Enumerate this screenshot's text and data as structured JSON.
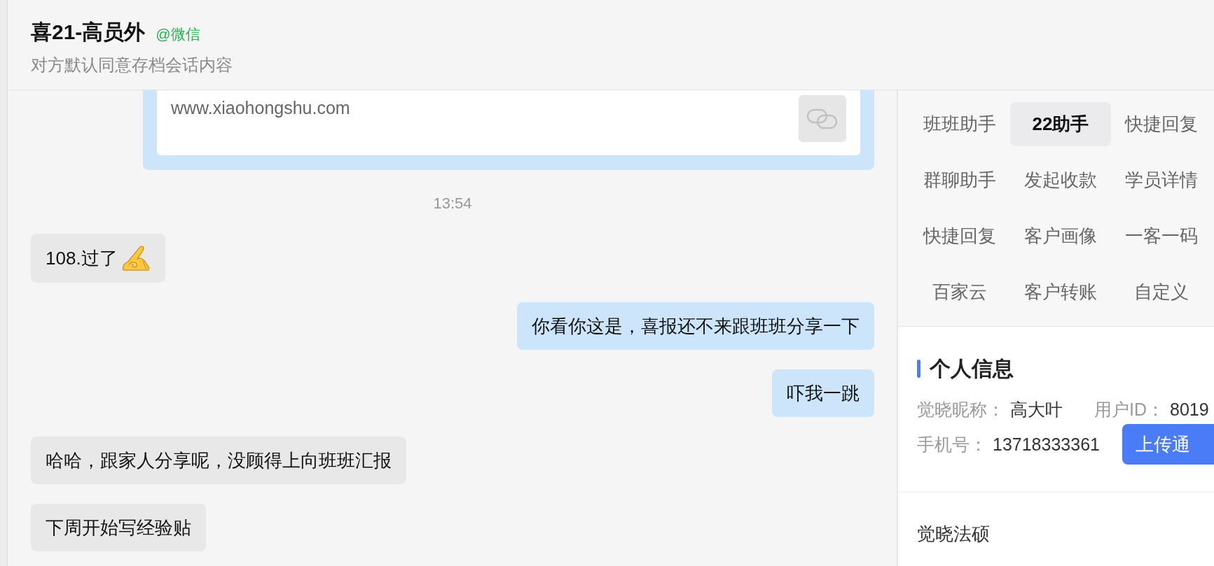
{
  "header": {
    "title": "喜21-高员外",
    "source": "@微信",
    "subtitle": "对方默认同意存档会话内容"
  },
  "messages": [
    {
      "kind": "link",
      "outgoing": true,
      "url": "www.xiaohongshu.com"
    },
    {
      "kind": "time",
      "text": "13:54"
    },
    {
      "kind": "text",
      "outgoing": false,
      "text": "108.过了",
      "emoji": true
    },
    {
      "kind": "text",
      "outgoing": true,
      "text": "你看你这是，喜报还不来跟班班分享一下",
      "emoji": false
    },
    {
      "kind": "text",
      "outgoing": true,
      "text": "吓我一跳",
      "emoji": false
    },
    {
      "kind": "text",
      "outgoing": false,
      "text": "哈哈，跟家人分享呢，没顾得上向班班汇报",
      "emoji": false
    },
    {
      "kind": "text",
      "outgoing": false,
      "text": "下周开始写经验贴",
      "emoji": false
    }
  ],
  "tools": {
    "tabs": [
      {
        "label": "班班助手",
        "selected": false
      },
      {
        "label": "22助手",
        "selected": true
      },
      {
        "label": "快捷回复",
        "selected": false
      },
      {
        "label": "群聊助手",
        "selected": false
      },
      {
        "label": "发起收款",
        "selected": false
      },
      {
        "label": "学员详情",
        "selected": false
      },
      {
        "label": "快捷回复",
        "selected": false
      },
      {
        "label": "客户画像",
        "selected": false
      },
      {
        "label": "一客一码",
        "selected": false
      },
      {
        "label": "百家云",
        "selected": false
      },
      {
        "label": "客户转账",
        "selected": false
      },
      {
        "label": "自定义",
        "selected": false
      }
    ]
  },
  "profile": {
    "title": "个人信息",
    "rows": [
      {
        "fields": [
          {
            "label": "觉晓昵称：",
            "value": "高大叶"
          },
          {
            "label": "用户ID：",
            "value": "8019"
          }
        ]
      },
      {
        "fields": [
          {
            "label": "手机号：",
            "value": "13718333361"
          }
        ],
        "button": "上传通"
      }
    ],
    "org": "觉晓法硕"
  }
}
